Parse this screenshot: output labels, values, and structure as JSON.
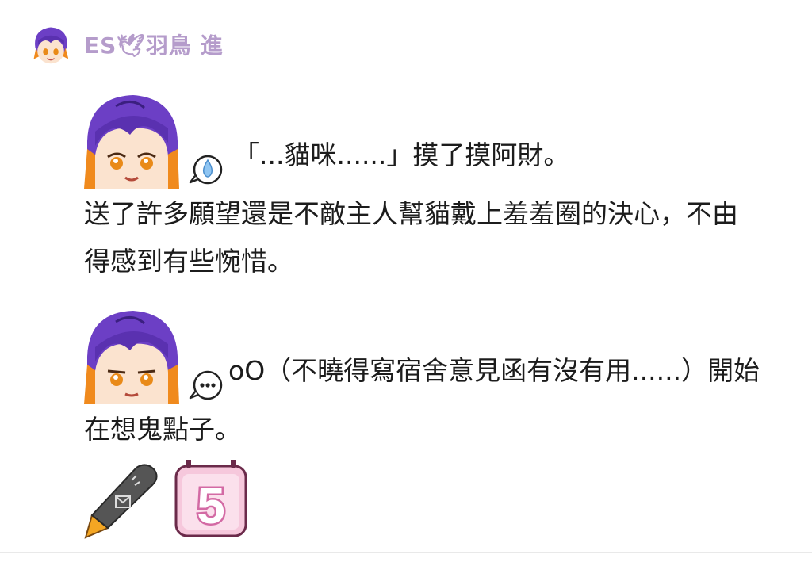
{
  "post": {
    "author_name": "ES🕊羽鳥 進",
    "message1": {
      "speech": "「...貓咪......」摸了摸阿財。",
      "line2": "送了許多願望還是不敵主人幫貓戴上羞羞圈的決心，不由",
      "line3": "得感到有些惋惜。",
      "bubble_icon": "sweat-drop-speech-icon"
    },
    "message2": {
      "speech": "oO（不曉得寫宿舍意見函有沒有用......）開始",
      "line2": "在想鬼點子。",
      "bubble_icon": "ellipsis-speech-icon"
    },
    "reactions": {
      "emoji1_icon": "pen-envelope-emoji",
      "emoji2_icon": "calendar-five-emoji",
      "calendar_number": "5"
    }
  },
  "colors": {
    "author": "#b59ccb",
    "hair": "#6c3fc5",
    "hair_accent": "#f08a1d",
    "eye": "#e98a18",
    "calendar_pink": "#f6c8dc",
    "calendar_border": "#d36aa4"
  }
}
